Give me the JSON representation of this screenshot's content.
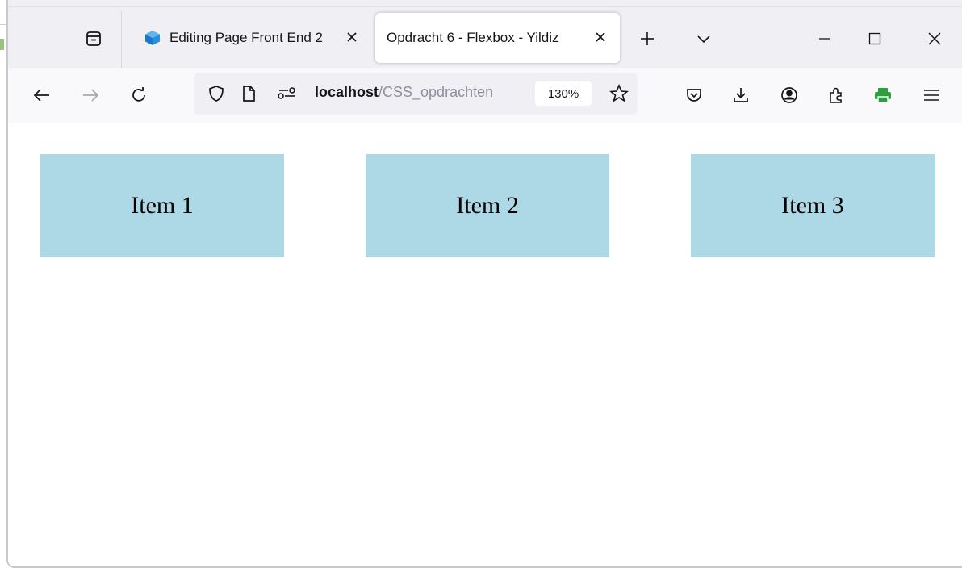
{
  "browser": {
    "tabs": [
      {
        "title": "Editing Page Front End 2",
        "active": false,
        "favicon": "cube-icon"
      },
      {
        "title": "Opdracht 6 - Flexbox - Yildiz",
        "active": true
      }
    ],
    "new_tab_icon": "plus-icon",
    "tab_list_icon": "chevron-down-icon",
    "window_controls": [
      "minimize-icon",
      "maximize-icon",
      "close-icon"
    ]
  },
  "navbar": {
    "url_host": "localhost",
    "url_path": "/CSS_opdrachten",
    "zoom": "130%"
  },
  "page": {
    "items": [
      {
        "label": "Item 1"
      },
      {
        "label": "Item 2"
      },
      {
        "label": "Item 3"
      }
    ],
    "item_color": "#add8e6"
  }
}
